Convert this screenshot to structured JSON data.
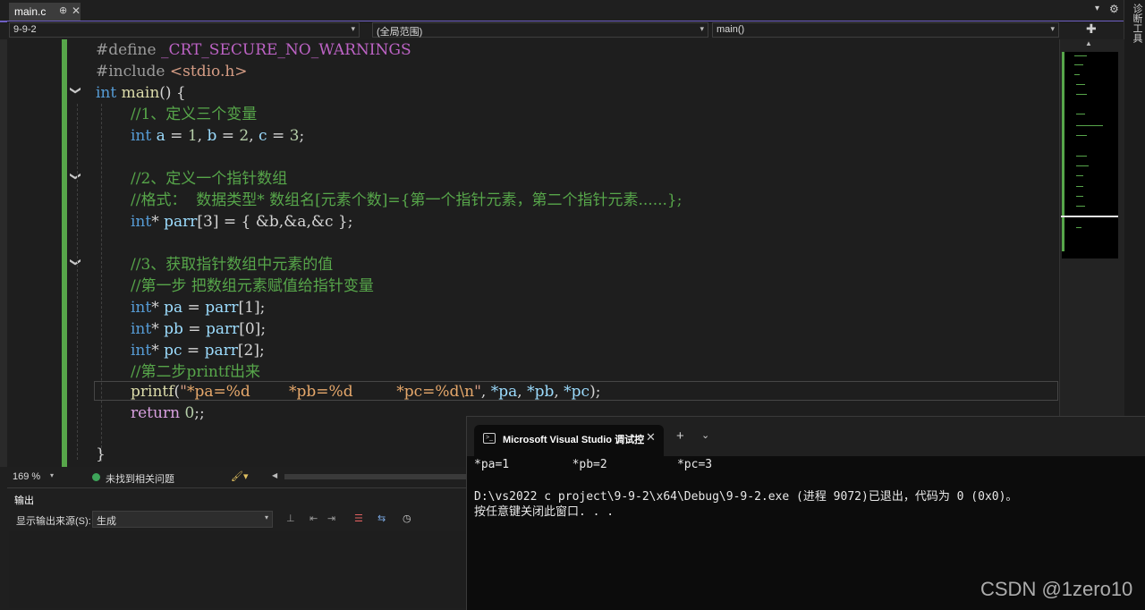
{
  "tab": {
    "filename": "main.c",
    "pin": "⊕",
    "close": "✕"
  },
  "window_controls": {
    "menu": "▾",
    "gear": "⚙"
  },
  "side_panel": {
    "label": "诊断工具"
  },
  "navbar": {
    "project": "9-9-2",
    "scope": "(全局范围)",
    "member": "main()",
    "arrow": "▾",
    "split": "✚"
  },
  "code": {
    "l1_pp": "#define",
    "l1_macro": " _CRT_SECURE_NO_WARNINGS",
    "l2_pp": "#include",
    "l2_file": " <stdio.h>",
    "l3_kw": "int",
    "l3_fn": " main",
    "l3_rest": "() {",
    "l4": "//1、定义三个变量",
    "l5_kw": "int",
    "l5_a": " a",
    "l5_e1": " = ",
    "l5_n1": "1",
    "l5_c1": ",",
    "l5_b": " b",
    "l5_e2": " = ",
    "l5_n2": "2",
    "l5_c2": ",",
    "l5_c": " c",
    "l5_e3": " = ",
    "l5_n3": "3",
    "l5_end": ";",
    "l7": "//2、定义一个指针数组",
    "l8": "//格式：  数据类型* 数组名[元素个数]={第一个指针元素，第二个指针元素......};",
    "l9_kw": "int",
    "l9_star": "*",
    "l9_id": " parr",
    "l9_rest": "[3] = { &b,&a,&c };",
    "l11": "//3、获取指针数组中元素的值",
    "l12": "//第一步 把数组元素赋值给指针变量",
    "l13_kw": "int",
    "l13_pre": "* ",
    "l13_id": "pa",
    "l13_eq": " = ",
    "l13_arr": "parr",
    "l13_rest": "[1];",
    "l14_kw": "int",
    "l14_pre": "* ",
    "l14_id": "pb",
    "l14_eq": " = ",
    "l14_arr": "parr",
    "l14_rest": "[0];",
    "l15_kw": "int",
    "l15_pre": "* ",
    "l15_id": "pc",
    "l15_eq": " = ",
    "l15_arr": "parr",
    "l15_rest": "[2];",
    "l16": "//第二步printf出来",
    "l17_fn": "printf",
    "l17_open": "(",
    "l17_q1": "\"",
    "l17_f1": "*pa=%d",
    "l17_sp1": "        ",
    "l17_f2": "*pb=%d",
    "l17_sp2": "         ",
    "l17_f3": "*pc=%d\\n",
    "l17_q2": "\"",
    "l17_args": ", ",
    "l17_a1": "*pa",
    "l17_c1": ", ",
    "l17_a2": "*pb",
    "l17_c2": ", ",
    "l17_a3": "*pc",
    "l17_end": ");",
    "l18_kw": "return",
    "l18_n": " 0",
    "l18_end": ";;",
    "l20": "}"
  },
  "fold_markers": {
    "glyph": "❯"
  },
  "minimap_up": "▲",
  "status": {
    "zoom": "169 %",
    "zoom_arrow": "▾",
    "issues": "未找到相关问题",
    "brush": "🖌▾",
    "scroll_left": "◀"
  },
  "output": {
    "title": "输出",
    "source_label": "显示输出来源(S):",
    "source_value": "生成",
    "source_arrow": "▾",
    "icons": [
      "⊥",
      "⇤",
      "⇥",
      "☰",
      "⇆",
      "◷"
    ]
  },
  "console": {
    "tab_title": "Microsoft Visual Studio 调试控",
    "close": "✕",
    "new_tab": "+",
    "dropdown": "⌄",
    "out1": "*pa=1         *pb=2          *pc=3",
    "out2": "D:\\vs2022 c project\\9-9-2\\x64\\Debug\\9-9-2.exe (进程 9072)已退出，代码为 0 (0x0)。",
    "out3": "按任意键关闭此窗口. . ."
  },
  "watermark": "CSDN @1zero10"
}
